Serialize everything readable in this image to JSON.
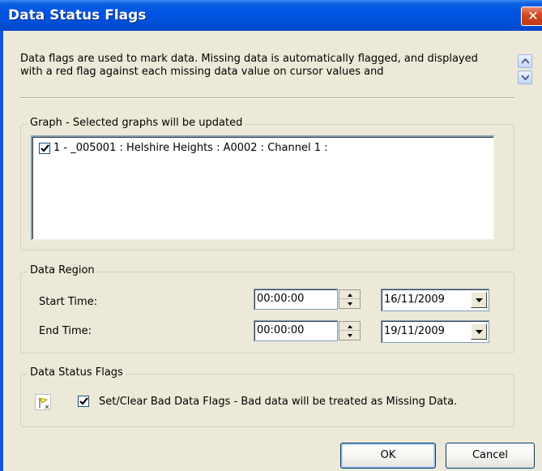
{
  "window": {
    "title": "Data Status Flags",
    "close_glyph": "✕"
  },
  "description": "Data flags are used to mark data. Missing data is automatically flagged, and displayed with a red flag against each missing data value on cursor values and",
  "graph_group": {
    "label": "Graph - Selected graphs will be updated",
    "items": [
      {
        "checked": true,
        "text": "1 - _005001 : Helshire Heights : A0002 : Channel 1 :"
      }
    ]
  },
  "data_region": {
    "label": "Data Region",
    "start_time": {
      "label": "Start Time:",
      "time": "00:00:00",
      "date": "16/11/2009"
    },
    "end_time": {
      "label": "End Time:",
      "time": "00:00:00",
      "date": "19/11/2009"
    }
  },
  "flags_group": {
    "label": "Data Status Flags",
    "icon": "flag-icon",
    "checkbox_checked": true,
    "checkbox_text": "Set/Clear Bad Data Flags - Bad data will be treated as Missing Data."
  },
  "buttons": {
    "ok": "OK",
    "cancel": "Cancel"
  },
  "colors": {
    "titlebar": "#0054e3",
    "close": "#c13a13",
    "dialog_bg": "#ece9d8"
  }
}
